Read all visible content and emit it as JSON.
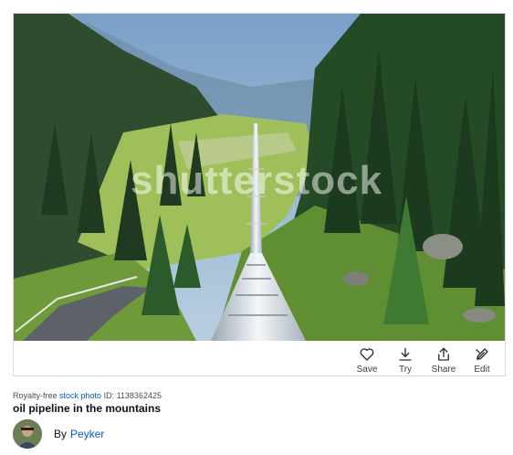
{
  "photo": {
    "watermark": "shutterstock",
    "alt": "oil pipeline in the mountains"
  },
  "actions": [
    {
      "label": "Save",
      "icon": "heart-icon"
    },
    {
      "label": "Try",
      "icon": "download-icon"
    },
    {
      "label": "Share",
      "icon": "share-icon"
    },
    {
      "label": "Edit",
      "icon": "edit-icon"
    }
  ],
  "meta": {
    "prefix": "Royalty-free",
    "type_link": "stock photo",
    "id_text": "ID: 1138362425",
    "title": "oil pipeline in the mountains"
  },
  "author": {
    "by_label": "By",
    "name": "Peyker"
  },
  "colors": {
    "link": "#0b58c4",
    "border": "#d9dbde"
  }
}
